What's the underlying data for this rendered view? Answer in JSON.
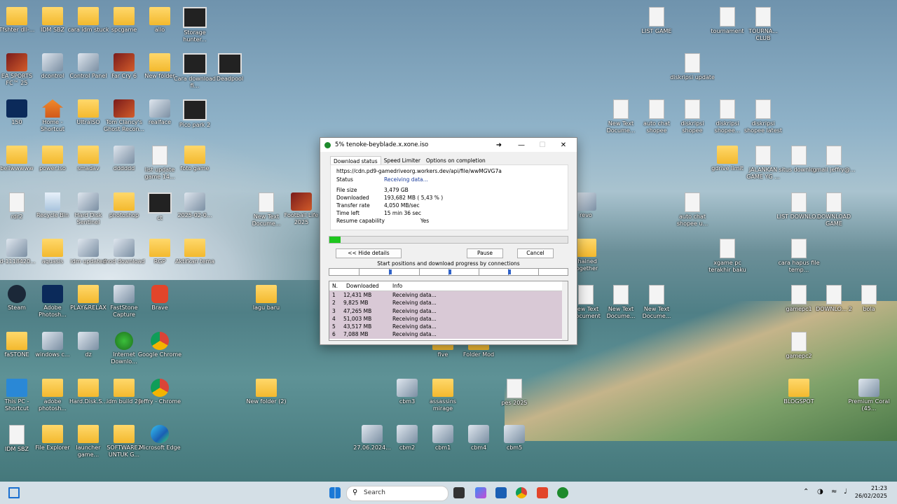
{
  "desktop_icons": [
    {
      "label": "Tfshter dll-...",
      "icon": "folder"
    },
    {
      "label": "IDM SBZ",
      "icon": "folder"
    },
    {
      "label": "cara idm stuck",
      "icon": "folder"
    },
    {
      "label": "spcgame",
      "icon": "folder"
    },
    {
      "label": "allo",
      "icon": "folder"
    },
    {
      "label": "Storage hunter...",
      "icon": "video"
    },
    {
      "label": "EA SPORTS FC™ 25",
      "icon": "game"
    },
    {
      "label": "dcontrol",
      "icon": "app"
    },
    {
      "label": "Control Panel",
      "icon": "app"
    },
    {
      "label": "Far Cry 6",
      "icon": "game"
    },
    {
      "label": "New folder",
      "icon": "folder"
    },
    {
      "label": "Cara download fi...",
      "icon": "video"
    },
    {
      "label": "Deadpool",
      "icon": "video"
    },
    {
      "label": "150",
      "icon": "psd"
    },
    {
      "label": "Home - Shortcut",
      "icon": "home"
    },
    {
      "label": "UltraISO",
      "icon": "folder"
    },
    {
      "label": "Tom Clancy's Ghost Recon...",
      "icon": "game"
    },
    {
      "label": "realface",
      "icon": "app"
    },
    {
      "label": "Pico park 2",
      "icon": "video"
    },
    {
      "label": "bellwwwww",
      "icon": "folder"
    },
    {
      "label": "power.iso",
      "icon": "folder"
    },
    {
      "label": "smadav",
      "icon": "folder"
    },
    {
      "label": "dddddd",
      "icon": "app"
    },
    {
      "label": "list update game 14...",
      "icon": "file"
    },
    {
      "label": "foto game",
      "icon": "folder"
    },
    {
      "label": "rdr2",
      "icon": "file"
    },
    {
      "label": "Recycle Bin",
      "icon": "bin"
    },
    {
      "label": "Hard Disk Sentinel",
      "icon": "app"
    },
    {
      "label": "photoshop",
      "icon": "folder"
    },
    {
      "label": "ct",
      "icon": "video"
    },
    {
      "label": "2025-02-0...",
      "icon": "app"
    },
    {
      "label": "id-1118420...",
      "icon": "app"
    },
    {
      "label": "aquasis",
      "icon": "folder"
    },
    {
      "label": "idm updated",
      "icon": "app"
    },
    {
      "label": "mod download",
      "icon": "app"
    },
    {
      "label": "RGP",
      "icon": "folder"
    },
    {
      "label": "Aktifkan tema",
      "icon": "folder"
    },
    {
      "label": "Steam",
      "icon": "steam"
    },
    {
      "label": "Adobe Photosh...",
      "icon": "ps"
    },
    {
      "label": "PLAY&RELAX",
      "icon": "folder"
    },
    {
      "label": "FastStone Capture",
      "icon": "app"
    },
    {
      "label": "Brave",
      "icon": "brave"
    },
    {
      "label": "lagu baru",
      "icon": "folder"
    },
    {
      "label": "faSTONE",
      "icon": "folder"
    },
    {
      "label": "windows c...",
      "icon": "app"
    },
    {
      "label": "dz",
      "icon": "app"
    },
    {
      "label": "Internet Downlo...",
      "icon": "idm"
    },
    {
      "label": "Google Chrome",
      "icon": "chrome"
    },
    {
      "label": "This PC - Shortcut",
      "icon": "pc"
    },
    {
      "label": "adobe photosh...",
      "icon": "folder"
    },
    {
      "label": "Hard.Disk.S...",
      "icon": "folder"
    },
    {
      "label": "idm build 20",
      "icon": "folder"
    },
    {
      "label": "Jeffry - Chrome",
      "icon": "chrome"
    },
    {
      "label": "New folder (2)",
      "icon": "folder"
    },
    {
      "label": "IDM SBZ",
      "icon": "file"
    },
    {
      "label": "File Explorer",
      "icon": "folder"
    },
    {
      "label": "launcher game...",
      "icon": "folder"
    },
    {
      "label": "SOFTWARE2 UNTUK G...",
      "icon": "folder"
    },
    {
      "label": "Microsoft Edge",
      "icon": "edge"
    },
    {
      "label": "New Text Docume...",
      "icon": "file"
    },
    {
      "label": "Football Life 2025",
      "icon": "game"
    },
    {
      "label": "five",
      "icon": "folder"
    },
    {
      "label": "Folder Mod",
      "icon": "folder"
    },
    {
      "label": "cbm3",
      "icon": "app"
    },
    {
      "label": "assassins mirage",
      "icon": "folder"
    },
    {
      "label": "pes 2025",
      "icon": "file"
    },
    {
      "label": "27.06.2024...",
      "icon": "app"
    },
    {
      "label": "cbm2",
      "icon": "app"
    },
    {
      "label": "cbm1",
      "icon": "app"
    },
    {
      "label": "cbm4",
      "icon": "app"
    },
    {
      "label": "cbm5",
      "icon": "app"
    },
    {
      "label": "LIST GAME",
      "icon": "file"
    },
    {
      "label": "tournament",
      "icon": "file"
    },
    {
      "label": "TOURNA... CLUB",
      "icon": "file"
    },
    {
      "label": "diskripsi update",
      "icon": "file"
    },
    {
      "label": "New Text Docume...",
      "icon": "file"
    },
    {
      "label": "auto chat shopee",
      "icon": "file"
    },
    {
      "label": "diskripsi shopee",
      "icon": "file"
    },
    {
      "label": "diskripsi shopee...",
      "icon": "file"
    },
    {
      "label": "diskripsi shopee latest",
      "icon": "file"
    },
    {
      "label": "gdrive limit",
      "icon": "folder"
    },
    {
      "label": "JALANKAN GAME YG ...",
      "icon": "file"
    },
    {
      "label": "situs downlo...",
      "icon": "file"
    },
    {
      "label": "gmail jeffry@...",
      "icon": "file"
    },
    {
      "label": "revo",
      "icon": "app"
    },
    {
      "label": "auto chat shopee u...",
      "icon": "file"
    },
    {
      "label": "LIST DOWNLO...",
      "icon": "file"
    },
    {
      "label": "DOWNLOAD GAME",
      "icon": "file"
    },
    {
      "label": "xgame pc terakhir baku",
      "icon": "file"
    },
    {
      "label": "cara hapus file temp...",
      "icon": "file"
    },
    {
      "label": "chained together",
      "icon": "folder"
    },
    {
      "label": "New Text Document",
      "icon": "file"
    },
    {
      "label": "New Text Docume...",
      "icon": "file"
    },
    {
      "label": "New Text Docume...",
      "icon": "file"
    },
    {
      "label": "gamepc1",
      "icon": "file"
    },
    {
      "label": "DOWNLO... 2",
      "icon": "file"
    },
    {
      "label": "bola",
      "icon": "file"
    },
    {
      "label": "gamepc2",
      "icon": "file"
    },
    {
      "label": "BLOGSPOT",
      "icon": "folder"
    },
    {
      "label": "Premium Coral (45...",
      "icon": "app"
    }
  ],
  "dialog": {
    "title": "5% tenoke-beyblade.x.xone.iso",
    "tabs": [
      "Download status",
      "Speed Limiter",
      "Options on completion"
    ],
    "url": "https://cdn.pd9-gamedriveorg.workers.dev/api/file/wwMGVG7a",
    "status_label": "Status",
    "status_value": "Receiving data...",
    "file_size_label": "File size",
    "file_size": "3,479  GB",
    "downloaded_label": "Downloaded",
    "downloaded": "193,682  MB  ( 5,43 % )",
    "transfer_rate_label": "Transfer rate",
    "transfer_rate": "4,050  MB/sec",
    "time_left_label": "Time left",
    "time_left": "15 min 36 sec",
    "resume_label": "Resume capability",
    "resume": "Yes",
    "progress": 0.0543,
    "hide_details": "<< Hide details",
    "pause": "Pause",
    "cancel": "Cancel",
    "connections_caption": "Start positions and download progress by connections",
    "table_headers": [
      "N.",
      "Downloaded",
      "Info"
    ],
    "rows": [
      {
        "n": "1",
        "downloaded": "12,431  MB",
        "info": "Receiving data..."
      },
      {
        "n": "2",
        "downloaded": "9,825  MB",
        "info": "Receiving data..."
      },
      {
        "n": "3",
        "downloaded": "47,265  MB",
        "info": "Receiving data..."
      },
      {
        "n": "4",
        "downloaded": "51,003  MB",
        "info": "Receiving data..."
      },
      {
        "n": "5",
        "downloaded": "43,517  MB",
        "info": "Receiving data..."
      },
      {
        "n": "6",
        "downloaded": "7,088  MB",
        "info": "Receiving data..."
      }
    ]
  },
  "taskbar": {
    "search_placeholder": "Search",
    "time": "21:23",
    "date": "26/02/2025"
  }
}
